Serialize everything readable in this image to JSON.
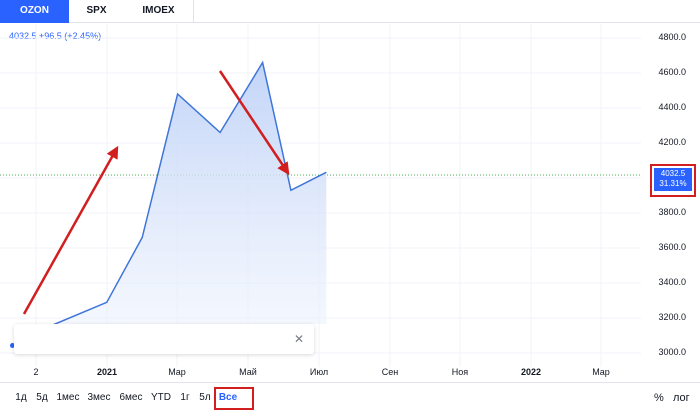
{
  "tabs": [
    {
      "label": "OZON",
      "active": true
    },
    {
      "label": "SPX",
      "active": false
    },
    {
      "label": "IMOEX",
      "active": false
    }
  ],
  "legend": {
    "text": "4032.5 +96.5 (+2.45%)"
  },
  "price_badge": {
    "price": "4032.5",
    "change": "31.31%"
  },
  "colors": {
    "accent": "#2962ff",
    "annotation": "#d21e1e",
    "area_fill": "#dbe6fb"
  },
  "chart_data": {
    "type": "area",
    "y_ticks": [
      "4800.0",
      "4600.0",
      "4400.0",
      "4200.0",
      "4000.0",
      "3800.0",
      "3600.0",
      "3400.0",
      "3200.0",
      "3000.0"
    ],
    "ylim": [
      2920,
      4880
    ],
    "x_ticks": [
      {
        "label": "2",
        "bold": false
      },
      {
        "label": "2021",
        "bold": true
      },
      {
        "label": "Мар",
        "bold": false
      },
      {
        "label": "Май",
        "bold": false
      },
      {
        "label": "Июл",
        "bold": false
      },
      {
        "label": "Сен",
        "bold": false
      },
      {
        "label": "Ноя",
        "bold": false
      },
      {
        "label": "2022",
        "bold": true
      },
      {
        "label": "Мар",
        "bold": false
      }
    ],
    "series": [
      {
        "points": [
          {
            "x": 0.0,
            "y": 3120
          },
          {
            "x": 1.0,
            "y": 3290
          },
          {
            "x": 1.5,
            "y": 3660
          },
          {
            "x": 2.0,
            "y": 4480
          },
          {
            "x": 2.6,
            "y": 4260
          },
          {
            "x": 3.2,
            "y": 4660
          },
          {
            "x": 3.6,
            "y": 3930
          },
          {
            "x": 4.1,
            "y": 4032.5
          }
        ]
      }
    ],
    "grid": true
  },
  "time_ranges": [
    {
      "label": "1д",
      "active": false
    },
    {
      "label": "5д",
      "active": false
    },
    {
      "label": "1мес",
      "active": false
    },
    {
      "label": "3мес",
      "active": false
    },
    {
      "label": "6мес",
      "active": false
    },
    {
      "label": "YTD",
      "active": false
    },
    {
      "label": "1г",
      "active": false
    },
    {
      "label": "5л",
      "active": false
    },
    {
      "label": "Все",
      "active": true
    }
  ],
  "right_tools": {
    "percent": "%",
    "log": "лог"
  },
  "tooltip": {
    "close": "✕"
  }
}
